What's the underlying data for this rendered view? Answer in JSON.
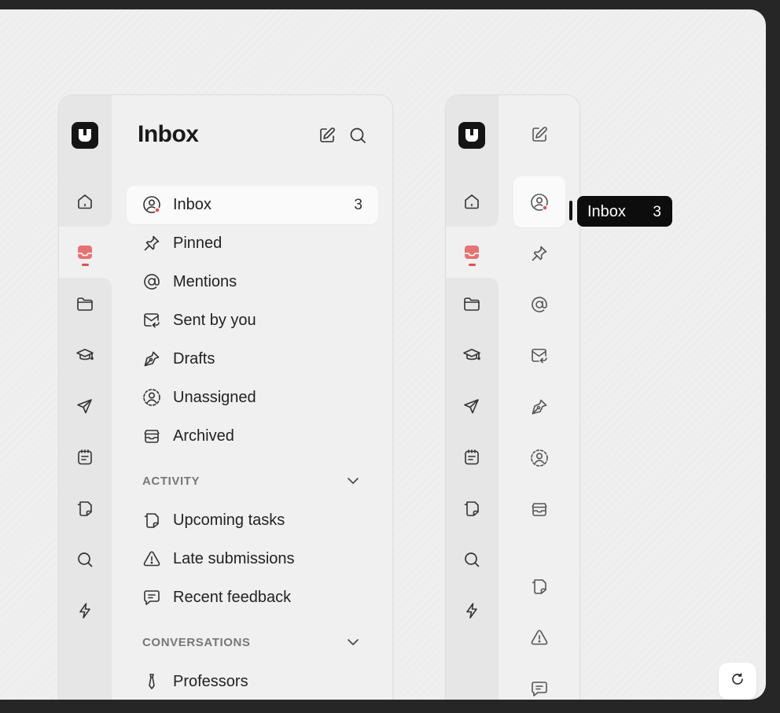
{
  "header": {
    "title": "Inbox",
    "compose_icon": "compose-icon",
    "search_icon": "search-icon"
  },
  "rail": {
    "icons": [
      "home-icon",
      "inbox-tray-icon",
      "folder-icon",
      "graduation-cap-icon",
      "send-icon",
      "notepad-icon",
      "sticky-notes-icon",
      "search-icon",
      "lightning-icon"
    ],
    "active": "inbox-tray-icon",
    "accent": "#d9534f"
  },
  "nav": {
    "items": [
      {
        "label": "Inbox",
        "count": "3",
        "icon": "user-circle-icon",
        "selected": true
      },
      {
        "label": "Pinned",
        "count": "",
        "icon": "pin-icon"
      },
      {
        "label": "Mentions",
        "count": "",
        "icon": "at-icon"
      },
      {
        "label": "Sent by you",
        "count": "",
        "icon": "mail-sent-icon"
      },
      {
        "label": "Drafts",
        "count": "",
        "icon": "pen-nib-icon"
      },
      {
        "label": "Unassigned",
        "count": "",
        "icon": "dashed-user-icon"
      },
      {
        "label": "Archived",
        "count": "",
        "icon": "archive-icon"
      }
    ]
  },
  "activity": {
    "title": "ACTIVITY",
    "items": [
      {
        "label": "Upcoming tasks",
        "icon": "sticky-notes-icon"
      },
      {
        "label": "Late submissions",
        "icon": "warning-icon"
      },
      {
        "label": "Recent feedback",
        "icon": "message-icon"
      }
    ]
  },
  "conversations": {
    "title": "CONVERSATIONS",
    "items": [
      {
        "label": "Professors",
        "icon": "tie-icon"
      }
    ]
  },
  "tooltip": {
    "label": "Inbox",
    "count": "3"
  },
  "refresh_icon": "refresh-icon"
}
